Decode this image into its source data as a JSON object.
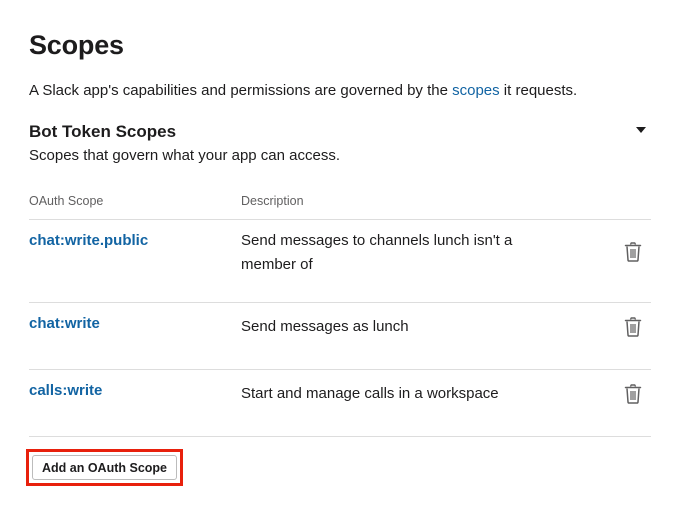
{
  "page": {
    "title": "Scopes",
    "intro_before": "A Slack app's capabilities and permissions are governed by the ",
    "intro_link": "scopes",
    "intro_after": " it requests."
  },
  "section": {
    "title": "Bot Token Scopes",
    "subtitle": "Scopes that govern what your app can access.",
    "toggle_icon": "caret-down-icon"
  },
  "table": {
    "headers": {
      "scope": "OAuth Scope",
      "description": "Description"
    },
    "rows": [
      {
        "scope": "chat:write.public",
        "description": "Send messages to channels lunch isn't a member of",
        "action_icon": "trash-icon"
      },
      {
        "scope": "chat:write",
        "description": "Send messages as lunch",
        "action_icon": "trash-icon"
      },
      {
        "scope": "calls:write",
        "description": "Start and manage calls in a workspace",
        "action_icon": "trash-icon"
      }
    ]
  },
  "actions": {
    "add_scope_label": "Add an OAuth Scope"
  },
  "colors": {
    "link": "#1264a3",
    "highlight": "#e8200c",
    "text": "#1d1c1d"
  }
}
